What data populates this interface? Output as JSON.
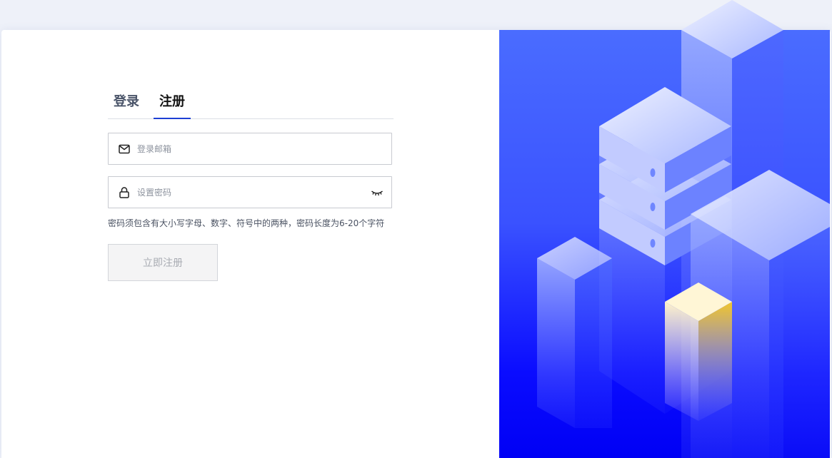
{
  "tabs": {
    "login_label": "登录",
    "register_label": "注册",
    "active": "register"
  },
  "form": {
    "email_placeholder": "登录邮箱",
    "email_value": "",
    "password_placeholder": "设置密码",
    "password_value": "",
    "password_hint": "密码须包含有大小写字母、数字、符号中的两种，密码长度为6-20个字符",
    "submit_label": "立即注册",
    "submit_disabled": true
  },
  "icons": {
    "email": "mail-icon",
    "password": "lock-icon",
    "toggle_visibility": "eye-closed-icon"
  },
  "colors": {
    "accent": "#1d3fd4",
    "illustration_blue": "#3a52ff",
    "illustration_yellow": "#f1c62b"
  }
}
